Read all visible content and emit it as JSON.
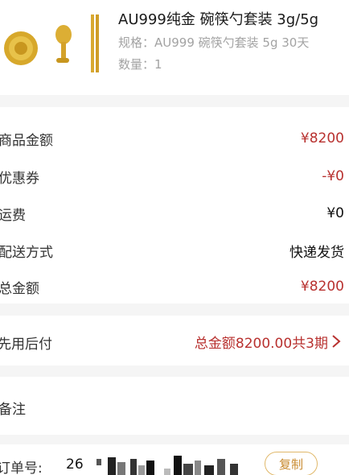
{
  "product": {
    "title": "AU999纯金 碗筷勺套装 3g/5g",
    "spec": "规格：AU999 碗筷勺套装 5g 30天",
    "quantity": "数量：1"
  },
  "summary": {
    "rows": [
      {
        "label": "商品金额",
        "value": "¥8200"
      },
      {
        "label": "优惠券",
        "value": "-¥0"
      },
      {
        "label": "运费",
        "value": "¥0"
      },
      {
        "label": "配送方式",
        "value": "快递发货"
      },
      {
        "label": "总金额",
        "value": "¥8200"
      }
    ]
  },
  "installment": {
    "label": "先用后付",
    "value": "总金额8200.00共3期"
  },
  "remark": {
    "label": "备注"
  },
  "order": {
    "label": "订单号:",
    "number_prefix": "26",
    "copy_label": "复制"
  },
  "colors": {
    "accent_red": "#b8312f",
    "copy_gold": "#c88a2e"
  }
}
